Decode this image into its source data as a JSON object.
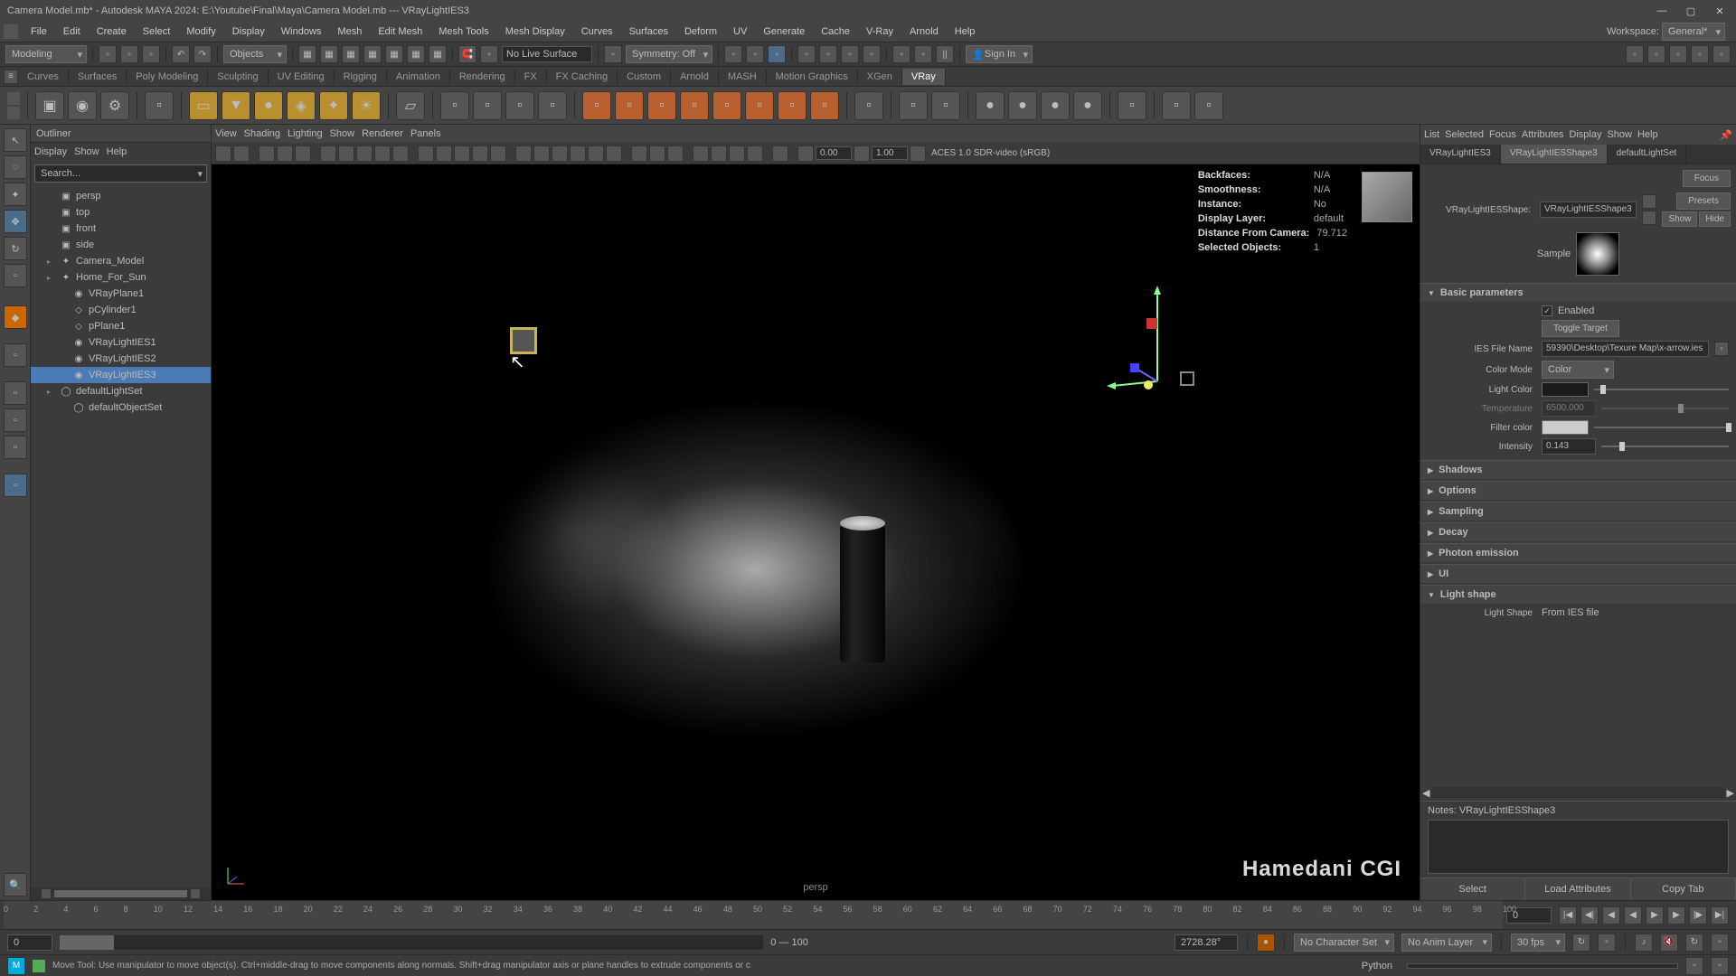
{
  "title": "Camera Model.mb* - Autodesk MAYA 2024: E:\\Youtube\\Final\\Maya\\Camera Model.mb  ---  VRayLightIES3",
  "menubar": [
    "File",
    "Edit",
    "Create",
    "Select",
    "Modify",
    "Display",
    "Windows",
    "Mesh",
    "Edit Mesh",
    "Mesh Tools",
    "Mesh Display",
    "Curves",
    "Surfaces",
    "Deform",
    "UV",
    "Generate",
    "Cache",
    "V-Ray",
    "Arnold",
    "Help"
  ],
  "workspace": {
    "label": "Workspace:",
    "value": "General*"
  },
  "toolbar1": {
    "mode": "Modeling",
    "live": "No Live Surface",
    "sym": "Symmetry: Off",
    "signin": "Sign In",
    "objects": "Objects"
  },
  "shelf_tabs": [
    "Curves",
    "Surfaces",
    "Poly Modeling",
    "Sculpting",
    "UV Editing",
    "Rigging",
    "Animation",
    "Rendering",
    "FX",
    "FX Caching",
    "Custom",
    "Arnold",
    "MASH",
    "Motion Graphics",
    "XGen",
    "VRay"
  ],
  "outliner": {
    "title": "Outliner",
    "menus": [
      "Display",
      "Show",
      "Help"
    ],
    "search": "Search...",
    "items": [
      {
        "label": "persp",
        "icon": "cam",
        "indent": 1
      },
      {
        "label": "top",
        "icon": "cam",
        "indent": 1
      },
      {
        "label": "front",
        "icon": "cam",
        "indent": 1
      },
      {
        "label": "side",
        "icon": "cam",
        "indent": 1
      },
      {
        "label": "Camera_Model",
        "icon": "grp",
        "indent": 1,
        "expand": true
      },
      {
        "label": "Home_For_Sun",
        "icon": "grp",
        "indent": 1,
        "expand": true
      },
      {
        "label": "VRayPlane1",
        "icon": "node",
        "indent": 2
      },
      {
        "label": "pCylinder1",
        "icon": "mesh",
        "indent": 2
      },
      {
        "label": "pPlane1",
        "icon": "mesh",
        "indent": 2
      },
      {
        "label": "VRayLightIES1",
        "icon": "light",
        "indent": 2
      },
      {
        "label": "VRayLightIES2",
        "icon": "light",
        "indent": 2
      },
      {
        "label": "VRayLightIES3",
        "icon": "light",
        "indent": 2,
        "selected": true
      },
      {
        "label": "defaultLightSet",
        "icon": "set",
        "indent": 1,
        "expand": true
      },
      {
        "label": "defaultObjectSet",
        "icon": "set",
        "indent": 2
      }
    ]
  },
  "viewport": {
    "menus": [
      "View",
      "Shading",
      "Lighting",
      "Show",
      "Renderer",
      "Panels"
    ],
    "num1": "0.00",
    "num2": "1.00",
    "colorspace": "ACES 1.0 SDR-video (sRGB)",
    "hud": {
      "backfaces": {
        "l": "Backfaces:",
        "v": "N/A"
      },
      "smooth": {
        "l": "Smoothness:",
        "v": "N/A"
      },
      "instance": {
        "l": "Instance:",
        "v": "No"
      },
      "layer": {
        "l": "Display Layer:",
        "v": "default"
      },
      "dist": {
        "l": "Distance From Camera:",
        "v": "79.712"
      },
      "sel": {
        "l": "Selected Objects:",
        "v": "1"
      }
    },
    "camlabel": "persp",
    "watermark": "Hamedani CGI"
  },
  "attr": {
    "menus": [
      "List",
      "Selected",
      "Focus",
      "Attributes",
      "Display",
      "Show",
      "Help"
    ],
    "tabs": [
      "VRayLightIES3",
      "VRayLightIESShape3",
      "defaultLightSet"
    ],
    "buttons": {
      "focus": "Focus",
      "presets": "Presets",
      "show": "Show",
      "hide": "Hide"
    },
    "shape_label": "VRayLightIESShape:",
    "shape_value": "VRayLightIESShape3",
    "sample": "Sample",
    "sections": {
      "basic": "Basic parameters",
      "shadows": "Shadows",
      "options": "Options",
      "sampling": "Sampling",
      "decay": "Decay",
      "photon": "Photon emission",
      "ui": "UI",
      "lshape": "Light shape"
    },
    "basic": {
      "enabled": "Enabled",
      "toggle": "Toggle Target",
      "file_l": "IES File Name",
      "file_v": "59390\\Desktop\\Texure Map\\x-arrow.ies",
      "cmode_l": "Color Mode",
      "cmode_v": "Color",
      "lcolor_l": "Light Color",
      "temp_l": "Temperature",
      "temp_v": "6500.000",
      "fcolor_l": "Filter color",
      "intens_l": "Intensity",
      "intens_v": "0.143"
    },
    "lshape": {
      "l": "Light Shape",
      "v": "From IES file"
    },
    "notes_l": "Notes: VRayLightIESShape3",
    "footer": [
      "Select",
      "Load Attributes",
      "Copy Tab"
    ]
  },
  "timeline": {
    "ticks": [
      "0",
      "2",
      "4",
      "6",
      "8",
      "10",
      "12",
      "14",
      "16",
      "18",
      "20",
      "22",
      "24",
      "26",
      "28",
      "30",
      "32",
      "34",
      "36",
      "38",
      "40",
      "42",
      "44",
      "46",
      "48",
      "50",
      "52",
      "54",
      "56",
      "58",
      "60",
      "62",
      "64",
      "66",
      "68",
      "70",
      "72",
      "74",
      "76",
      "78",
      "80",
      "82",
      "84",
      "86",
      "88",
      "90",
      "92",
      "94",
      "96",
      "98",
      "100"
    ],
    "current": "0"
  },
  "range": {
    "start": "0",
    "label": "0 — 100",
    "rot": "2728.28°",
    "charset": "No Character Set",
    "animlayer": "No Anim Layer",
    "fps": "30 fps"
  },
  "status": {
    "text": "Move Tool: Use manipulator to move object(s). Ctrl+middle-drag to move components along normals. Shift+drag manipulator axis or plane handles to extrude components or c",
    "script": "Python"
  }
}
